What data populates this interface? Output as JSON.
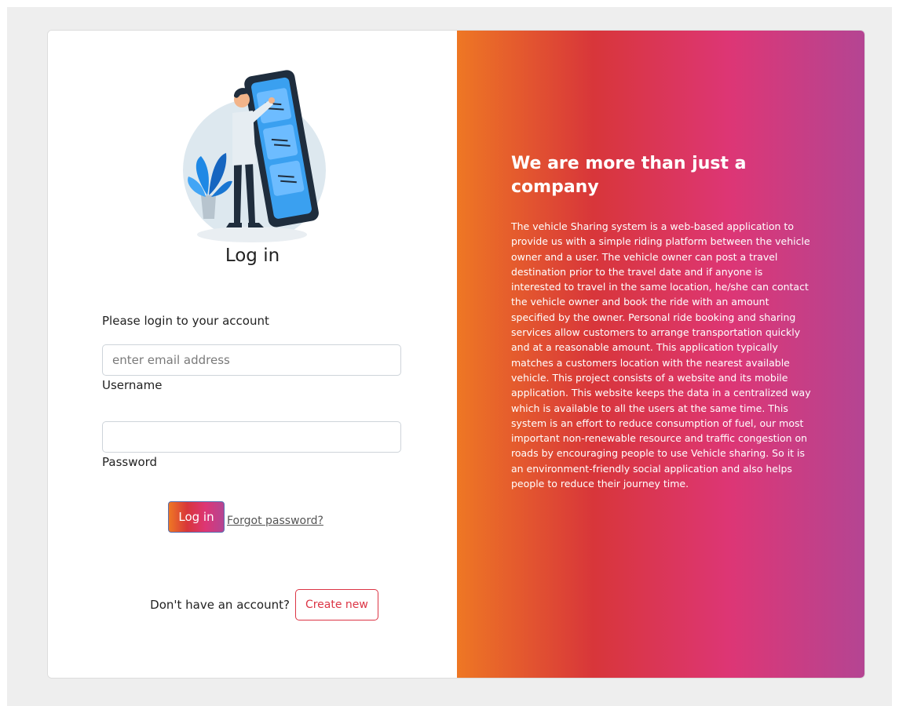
{
  "login": {
    "title": "Log in",
    "prompt": "Please login to your account",
    "email_placeholder": "enter email address",
    "email_value": "",
    "username_label": "Username",
    "password_value": "",
    "password_label": "Password",
    "login_button_label": "Log in",
    "forgot_password_label": "Forgot password?",
    "signup_prompt": "Don't have an account?",
    "create_button_label": "Create new"
  },
  "tagline": {
    "heading": "We are more than just a company",
    "body": "The vehicle Sharing system is a web-based application to provide us with a simple riding platform between the vehicle owner and a user. The vehicle owner can post a travel destination prior to the travel date and if anyone is interested to travel in the same location, he/she can contact the vehicle owner and book the ride with an amount specified by the owner. Personal ride booking and sharing services allow customers to arrange transportation quickly and at a reasonable amount. This application typically matches a customers location with the nearest available vehicle. This project consists of a website and its mobile application. This website keeps the data in a centralized way which is available to all the users at the same time. This system is an effort to reduce consumption of fuel, our most important non-renewable resource and traffic congestion on roads by encouraging people to use Vehicle sharing. So it is an environment-friendly social application and also helps people to reduce their journey time."
  },
  "colors": {
    "gradient": [
      "#ee7724",
      "#d8363a",
      "#dd3675",
      "#b44593"
    ],
    "create_button_border": "#dc3545"
  },
  "icons": {
    "illustration": "person-with-phone-illustration"
  }
}
